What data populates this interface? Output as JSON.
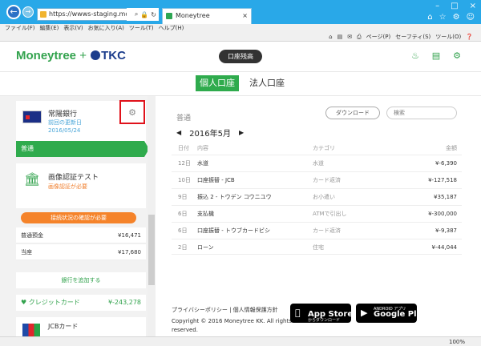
{
  "browser": {
    "url": "https://wwws-staging.moneytre",
    "tab_title": "Moneytree",
    "menu": [
      "ファイル(F)",
      "編集(E)",
      "表示(V)",
      "お気に入り(A)",
      "ツール(T)",
      "ヘルプ(H)"
    ],
    "commands": [
      "ページ(P)",
      "セーフティ(S)",
      "ツール(O)"
    ],
    "zoom": "100%"
  },
  "app": {
    "logo_main": "Moneytree",
    "logo_plus": "+",
    "logo_partner": "TKC",
    "balance_button": "口座残高",
    "type_tabs": [
      "個人口座",
      "法人口座"
    ]
  },
  "sidebar": {
    "bank": {
      "name": "常陽銀行",
      "updated_label": "前回の更新日",
      "updated_date": "2016/05/24"
    },
    "selected_account": "普通",
    "auth_bank": {
      "name": "画像認証テスト",
      "status": "画像認証が必要"
    },
    "warning": "接続状況の確認が必要",
    "accounts": [
      {
        "name": "普通預金",
        "amount": "¥16,471"
      },
      {
        "name": "当座",
        "amount": "¥17,680"
      }
    ],
    "add_bank": "銀行を追加する",
    "credit_card": {
      "label": "クレジットカード",
      "amount": "¥-243,278"
    },
    "card_name": "JCBカード"
  },
  "main": {
    "account_title": "普通",
    "download": "ダウンロード",
    "search_placeholder": "検索",
    "month": "2016年5月",
    "headers": {
      "date": "日付",
      "desc": "内容",
      "cat": "カテゴリ",
      "amt": "金額"
    },
    "transactions": [
      {
        "day": "12日",
        "desc": "水道",
        "cat": "水道",
        "amt": "¥-6,390"
      },
      {
        "day": "10日",
        "desc": "口座振替 - JCB",
        "cat": "カード返済",
        "amt": "¥-127,518"
      },
      {
        "day": "9日",
        "desc": "振込 2 - トウデン コウニユウ",
        "cat": "お小遣い",
        "amt": "¥35,187"
      },
      {
        "day": "6日",
        "desc": "支払機",
        "cat": "ATMで引出し",
        "amt": "¥-300,000"
      },
      {
        "day": "6日",
        "desc": "口座振替 - トウブカードビシ",
        "cat": "カード返済",
        "amt": "¥-9,387"
      },
      {
        "day": "2日",
        "desc": "ローン",
        "cat": "住宅",
        "amt": "¥-44,044"
      }
    ],
    "footer_links": "プライバシーポリシー | 個人情報保護方針",
    "copyright": "Copyright © 2016 Moneytree KK. All rights reserved.",
    "appstore_small": "",
    "appstore_big": "App Store",
    "appstore_sub": "からダウンロード",
    "gplay_small": "ANDROID アプリ",
    "gplay_big": "Google Play"
  },
  "colors": {
    "brand_green": "#2fab4d",
    "warning_orange": "#f5832a",
    "highlight_red": "#e0121b",
    "tkc_blue": "#1c3d8c"
  }
}
